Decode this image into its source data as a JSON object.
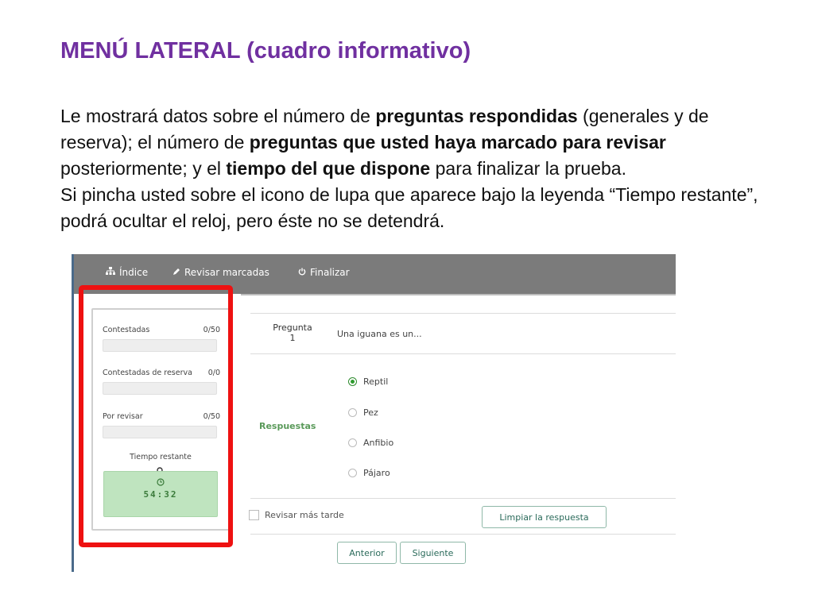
{
  "slide": {
    "title": "MENÚ LATERAL  (cuadro informativo)",
    "p1_a": "Le mostrará datos sobre el número de ",
    "p1_b": "preguntas respondidas",
    "p1_c": " (generales y de reserva); el número de ",
    "p1_d": "preguntas que usted haya marcado para revisar",
    "p1_e": " posteriormente; y el ",
    "p1_f": "tiempo del que dispone",
    "p1_g": " para finalizar la prueba.",
    "p2": "Si pincha usted sobre el icono de lupa que aparece bajo la leyenda “Tiempo restante”, podrá ocultar el reloj, pero éste no se detendrá."
  },
  "nav": {
    "indice": "Índice",
    "revisar": "Revisar marcadas",
    "finalizar": "Finalizar"
  },
  "sidebar": {
    "contestadas": {
      "label": "Contestadas",
      "value": "0/50"
    },
    "reserva": {
      "label": "Contestadas de reserva",
      "value": "0/0"
    },
    "por_revisar": {
      "label": "Por revisar",
      "value": "0/50"
    },
    "timer_label": "Tiempo restante",
    "timer_value": "54:32"
  },
  "question": {
    "label": "Pregunta",
    "number": "1",
    "text": "Una iguana es un...",
    "answers_label": "Respuestas",
    "options": [
      "Reptil",
      "Pez",
      "Anfibio",
      "Pájaro"
    ],
    "selected": "Reptil"
  },
  "controls": {
    "review_later": "Revisar más tarde",
    "clear": "Limpiar la respuesta",
    "previous": "Anterior",
    "next": "Siguiente"
  },
  "colors": {
    "title": "#7030a0",
    "highlight_frame": "#ee1111",
    "timer_bg": "#bfe4bf",
    "nav_bg": "#7b7b7b"
  }
}
